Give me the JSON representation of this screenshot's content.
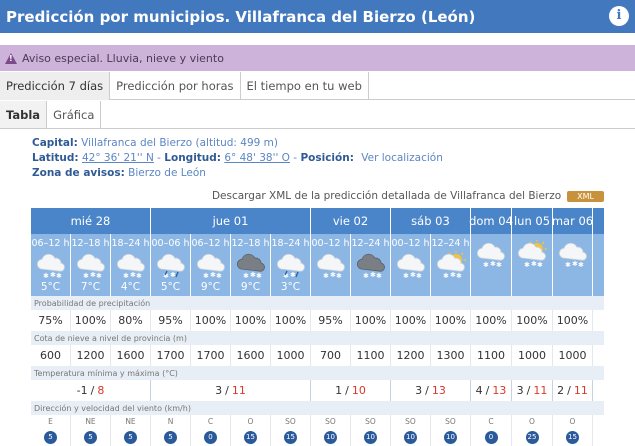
{
  "header": {
    "title": "Predicción por municipios. Villafranca del Bierzo (León)",
    "info_icon": "info-icon"
  },
  "alert": {
    "text": "Aviso especial. Lluvia, nieve y viento"
  },
  "tabs": [
    {
      "label": "Predicción 7 días",
      "active": true
    },
    {
      "label": "Predicción por horas",
      "active": false
    },
    {
      "label": "El tiempo en tu web",
      "active": false
    }
  ],
  "subtabs": [
    {
      "label": "Tabla",
      "active": true
    },
    {
      "label": "Gráfica",
      "active": false
    }
  ],
  "meta": {
    "capital_label": "Capital:",
    "capital_value": "Villafranca del Bierzo (altitud: 499 m)",
    "lat_label": "Latitud:",
    "lat_value": "42° 36' 21'' N",
    "lon_label": "Longitud:",
    "lon_value": "6° 48' 38'' O",
    "pos_label": "Posición:",
    "pos_value": "Ver localización",
    "zone_label": "Zona de avisos:",
    "zone_value": "Bierzo de León",
    "sep": "-"
  },
  "xml": {
    "text": "Descargar XML de la predicción detallada de Villafranca del Bierzo",
    "badge": "XML"
  },
  "days": [
    {
      "label": "mié 28",
      "cols": 3
    },
    {
      "label": "jue 01",
      "cols": 4
    },
    {
      "label": "vie 02",
      "cols": 2
    },
    {
      "label": "sáb 03",
      "cols": 2
    },
    {
      "label": "dom 04",
      "cols": 1
    },
    {
      "label": "lun 05",
      "cols": 1
    },
    {
      "label": "mar 06",
      "cols": 1
    }
  ],
  "periods": [
    {
      "hr": "06–12 h",
      "icon": "snow",
      "temp": "5°C"
    },
    {
      "hr": "12–18 h",
      "icon": "snow",
      "temp": "7°C"
    },
    {
      "hr": "18–24 h",
      "icon": "snow",
      "temp": "4°C"
    },
    {
      "hr": "00–06 h",
      "icon": "snow-rain",
      "temp": "5°C"
    },
    {
      "hr": "06–12 h",
      "icon": "snow",
      "temp": "9°C"
    },
    {
      "hr": "12–18 h",
      "icon": "snow-dark",
      "temp": "9°C"
    },
    {
      "hr": "18–24 h",
      "icon": "snow-rain",
      "temp": "3°C"
    },
    {
      "hr": "00–12 h",
      "icon": "snow",
      "temp": ""
    },
    {
      "hr": "12–24 h",
      "icon": "snow-dark",
      "temp": ""
    },
    {
      "hr": "00–12 h",
      "icon": "snow",
      "temp": ""
    },
    {
      "hr": "12–24 h",
      "icon": "sun-snow",
      "temp": ""
    },
    {
      "hr": "",
      "icon": "snow",
      "temp": ""
    },
    {
      "hr": "",
      "icon": "sun-snow",
      "temp": ""
    },
    {
      "hr": "",
      "icon": "snow",
      "temp": ""
    }
  ],
  "rows": {
    "precip_label": "Probabilidad de precipitación",
    "precip": [
      "75%",
      "100%",
      "80%",
      "95%",
      "100%",
      "100%",
      "100%",
      "95%",
      "100%",
      "100%",
      "100%",
      "100%",
      "100%",
      "100%"
    ],
    "snow_label": "Cota de nieve a nivel de provincia (m)",
    "snow": [
      "600",
      "1200",
      "1600",
      "1700",
      "1700",
      "1600",
      "1000",
      "700",
      "1100",
      "1200",
      "1300",
      "1100",
      "1000",
      "1000"
    ],
    "temp_label": "Temperatura mínima y máxima (°C)",
    "temp": [
      {
        "min": "-1",
        "max": "8",
        "span": 3
      },
      {
        "min": "3",
        "max": "11",
        "span": 4
      },
      {
        "min": "1",
        "max": "10",
        "span": 2
      },
      {
        "min": "3",
        "max": "13",
        "span": 2
      },
      {
        "min": "4",
        "max": "13",
        "span": 1
      },
      {
        "min": "3",
        "max": "11",
        "span": 1
      },
      {
        "min": "2",
        "max": "11",
        "span": 1
      }
    ],
    "slash": "/",
    "wind_label": "Dirección y velocidad del viento (km/h)",
    "wind": [
      {
        "dir": "E",
        "speed": "5"
      },
      {
        "dir": "NE",
        "speed": "5"
      },
      {
        "dir": "NE",
        "speed": "5"
      },
      {
        "dir": "N",
        "speed": "5"
      },
      {
        "dir": "C",
        "speed": "0"
      },
      {
        "dir": "O",
        "speed": "15"
      },
      {
        "dir": "SO",
        "speed": "15"
      },
      {
        "dir": "SO",
        "speed": "10"
      },
      {
        "dir": "SO",
        "speed": "10"
      },
      {
        "dir": "SO",
        "speed": "10"
      },
      {
        "dir": "SO",
        "speed": "10"
      },
      {
        "dir": "C",
        "speed": "0"
      },
      {
        "dir": "O",
        "speed": "25"
      },
      {
        "dir": "O",
        "speed": "15"
      }
    ]
  }
}
